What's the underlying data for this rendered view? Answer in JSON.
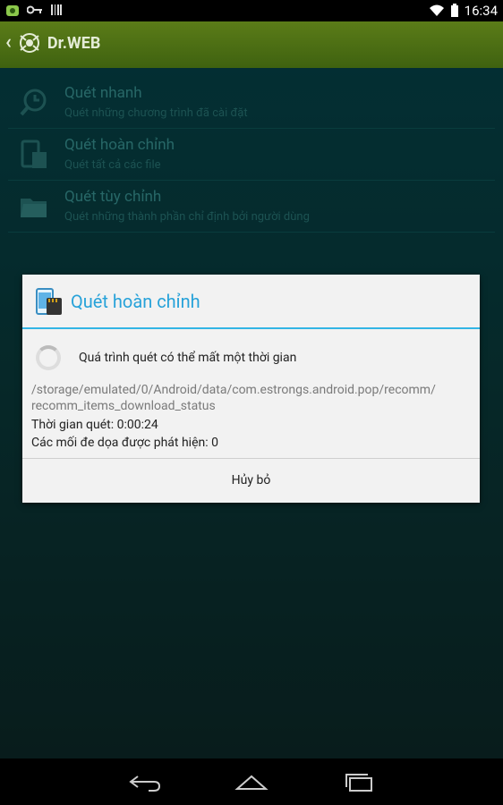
{
  "status_bar": {
    "time": "16:34"
  },
  "app": {
    "brand": "Dr.WEB"
  },
  "scan_list": [
    {
      "title": "Quét nhanh",
      "subtitle": "Quét những chương trình đã cài đặt",
      "icon": "clock-search-icon"
    },
    {
      "title": "Quét hoàn chỉnh",
      "subtitle": "Quét tất cả các file",
      "icon": "device-sdcard-icon"
    },
    {
      "title": "Quét tùy chỉnh",
      "subtitle": "Quét những thành phần chỉ định bởi người dùng",
      "icon": "folder-icon"
    }
  ],
  "dialog": {
    "title": "Quét hoàn chỉnh",
    "message": "Quá trình quét có thể mất một thời gian",
    "path": "/storage/emulated/0/Android/data/com.estrongs.android.pop/recomm/ recomm_items_download_status",
    "scan_time_label": "Thời gian quét:",
    "scan_time_value": "0:00:24",
    "threats_label": "Các mối đe dọa được phát hiện:",
    "threats_value": "0",
    "cancel_label": "Hủy bỏ"
  },
  "colors": {
    "accent": "#33b5e5",
    "action_bar": "#4e7014"
  }
}
